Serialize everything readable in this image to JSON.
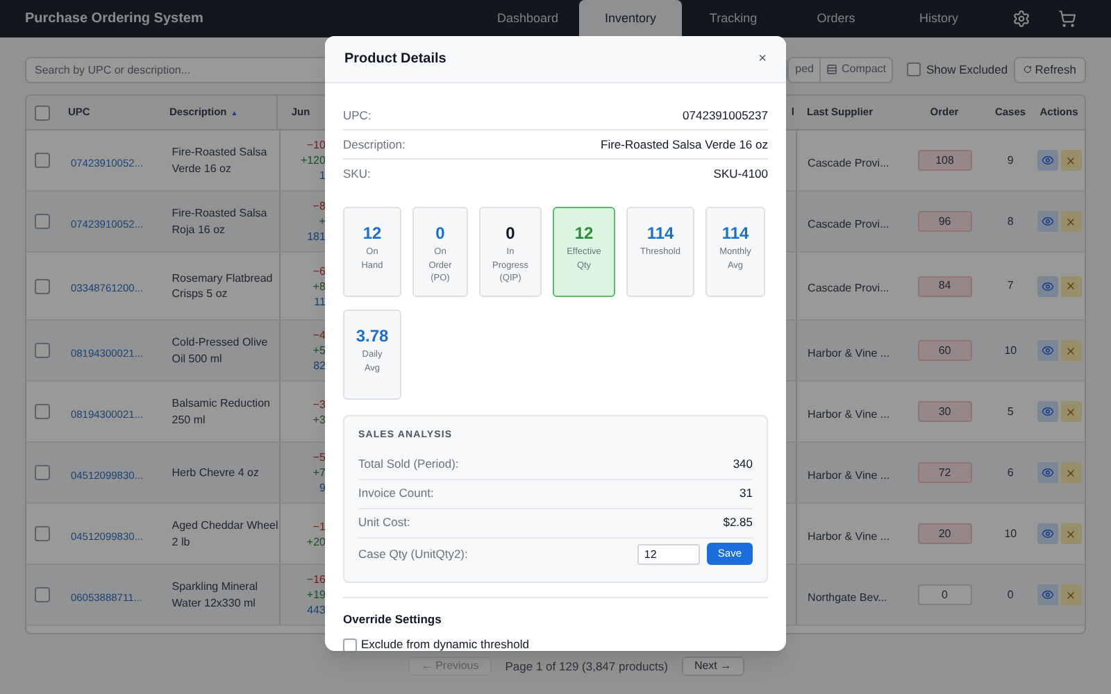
{
  "app_title": "Purchase Ordering System",
  "nav_tabs": [
    {
      "label": "Dashboard",
      "selected": false
    },
    {
      "label": "Inventory",
      "selected": true
    },
    {
      "label": "Tracking",
      "selected": false
    },
    {
      "label": "Orders",
      "selected": false
    },
    {
      "label": "History",
      "selected": false
    }
  ],
  "toolbar": {
    "search": {
      "placeholder": "Search by UPC or description..."
    },
    "view_toggle": [
      {
        "label": "ped",
        "selected": false
      },
      {
        "label": "Compact",
        "selected": false
      }
    ],
    "show_excluded": {
      "label": "Show Excluded",
      "checked": false
    },
    "refresh": "Refresh"
  },
  "table": {
    "select_all_checked": false,
    "columns": [
      {
        "label": "UPC"
      },
      {
        "label": "Description",
        "sort": "▲"
      },
      {
        "label": "Jun"
      },
      {
        "label": "l"
      },
      {
        "label": "Last Supplier"
      },
      {
        "label": "Order"
      },
      {
        "label": "Cases"
      },
      {
        "label": "Actions"
      }
    ],
    "rows": [
      {
        "checked": false,
        "upc": "07423910052...",
        "description": "Fire-Roasted Salsa Verde 16 oz",
        "jun": [
          "−10",
          "+120",
          "1"
        ],
        "supplier": "Cascade Provi...",
        "order": "108",
        "order_flagged": true,
        "cases": "9"
      },
      {
        "checked": false,
        "upc": "07423910052...",
        "description": "Fire-Roasted Salsa Roja 16 oz",
        "jun": [
          "−8",
          "+",
          "181"
        ],
        "supplier": "Cascade Provi...",
        "order": "96",
        "order_flagged": true,
        "cases": "8"
      },
      {
        "checked": false,
        "upc": "03348761200...",
        "description": "Rosemary Flatbread Crisps 5 oz",
        "jun": [
          "−6",
          "+8",
          "11"
        ],
        "supplier": "Cascade Provi...",
        "order": "84",
        "order_flagged": true,
        "cases": "7"
      },
      {
        "checked": false,
        "upc": "08194300021...",
        "description": "Cold-Pressed Olive Oil 500 ml",
        "jun": [
          "−4",
          "+5",
          "82"
        ],
        "supplier": "Harbor & Vine ...",
        "order": "60",
        "order_flagged": true,
        "cases": "10"
      },
      {
        "checked": false,
        "upc": "08194300021...",
        "description": "Balsamic Reduction 250 ml",
        "jun": [
          "−3",
          "+3"
        ],
        "supplier": "Harbor & Vine ...",
        "order": "30",
        "order_flagged": true,
        "cases": "5"
      },
      {
        "checked": false,
        "upc": "04512099830...",
        "description": "Herb Chevre 4 oz",
        "jun": [
          "−5",
          "+7",
          "9"
        ],
        "supplier": "Harbor & Vine ...",
        "order": "72",
        "order_flagged": true,
        "cases": "6"
      },
      {
        "checked": false,
        "upc": "04512099830...",
        "description": "Aged Cheddar Wheel 2 lb",
        "jun": [
          "−1",
          "+20"
        ],
        "supplier": "Harbor & Vine ...",
        "order": "20",
        "order_flagged": true,
        "cases": "10"
      },
      {
        "checked": false,
        "upc": "06053888711...",
        "description": "Sparkling Mineral Water 12x330 ml",
        "jun": [
          "−16",
          "+19",
          "443"
        ],
        "supplier": "Northgate Bev...",
        "order": "0",
        "order_flagged": false,
        "cases": "0"
      }
    ]
  },
  "pagination": {
    "previous": {
      "label": "← Previous",
      "disabled": true
    },
    "info": "Page 1 of 129 (3,847 products)",
    "next": {
      "label": "Next →",
      "disabled": false
    }
  },
  "modal": {
    "title": "Product Details",
    "close": "×",
    "fields": [
      {
        "label": "UPC:",
        "value": "0742391005237"
      },
      {
        "label": "Description:",
        "value": "Fire-Roasted Salsa Verde 16 oz"
      },
      {
        "label": "SKU:",
        "value": "SKU-4100"
      }
    ],
    "stats": [
      {
        "value": "12",
        "label": "On Hand",
        "kind": "metric"
      },
      {
        "value": "0",
        "label": "On Order (PO)",
        "kind": "metric"
      },
      {
        "value": "0",
        "label": "In Progress (QIP)",
        "kind": "neutral"
      },
      {
        "value": "12",
        "label": "Effective Qty",
        "kind": "highlight"
      },
      {
        "value": "114",
        "label": "Threshold",
        "kind": "metric"
      },
      {
        "value": "114",
        "label": "Monthly Avg",
        "kind": "metric"
      },
      {
        "value": "3.78",
        "label": "Daily Avg",
        "kind": "metric"
      }
    ],
    "sales": {
      "title": "SALES ANALYSIS",
      "rows": [
        {
          "label": "Total Sold (Period):",
          "value": "340"
        },
        {
          "label": "Invoice Count:",
          "value": "31"
        },
        {
          "label": "Unit Cost:",
          "value": "$2.85"
        }
      ],
      "case_qty": {
        "label": "Case Qty (UnitQty2):",
        "value": "12",
        "button": "Save"
      }
    },
    "override": {
      "title": "Override Settings",
      "checkbox": {
        "label": "Exclude from dynamic threshold",
        "checked": false
      }
    }
  }
}
